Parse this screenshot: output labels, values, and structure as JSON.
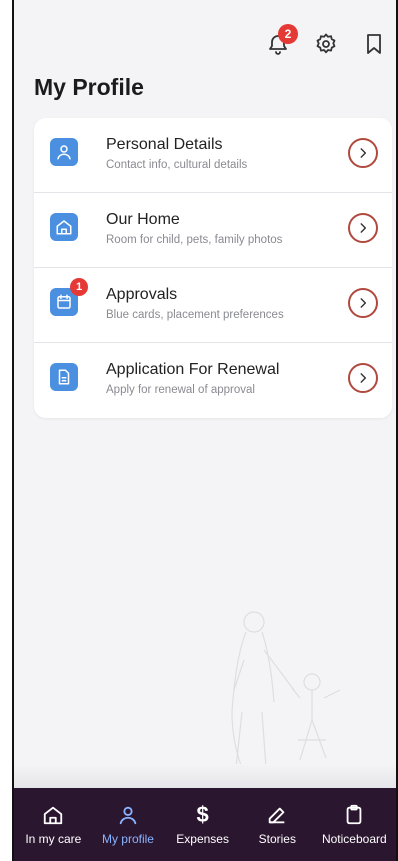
{
  "header": {
    "notification_count": "2",
    "title": "My Profile"
  },
  "profile_items": [
    {
      "title": "Personal Details",
      "subtitle": "Contact info, cultural details",
      "icon": "person-icon",
      "badge": ""
    },
    {
      "title": "Our Home",
      "subtitle": "Room for child, pets, family photos",
      "icon": "home-icon",
      "badge": ""
    },
    {
      "title": "Approvals",
      "subtitle": "Blue cards, placement preferences",
      "icon": "calendar-icon",
      "badge": "1"
    },
    {
      "title": "Application For Renewal",
      "subtitle": "Apply for renewal of approval",
      "icon": "document-icon",
      "badge": ""
    }
  ],
  "bottom_nav": [
    {
      "label": "In my care",
      "icon": "home-icon",
      "active": false
    },
    {
      "label": "My profile",
      "icon": "person-icon",
      "active": true
    },
    {
      "label": "Expenses",
      "icon": "dollar-icon",
      "active": false
    },
    {
      "label": "Stories",
      "icon": "edit-icon",
      "active": false
    },
    {
      "label": "Noticeboard",
      "icon": "clipboard-icon",
      "active": false
    }
  ],
  "colors": {
    "accent": "#4a8fe0",
    "chevron_ring": "#b0493e",
    "badge": "#e53935",
    "nav_background": "#2b1630",
    "nav_active": "#8ab4ff"
  }
}
